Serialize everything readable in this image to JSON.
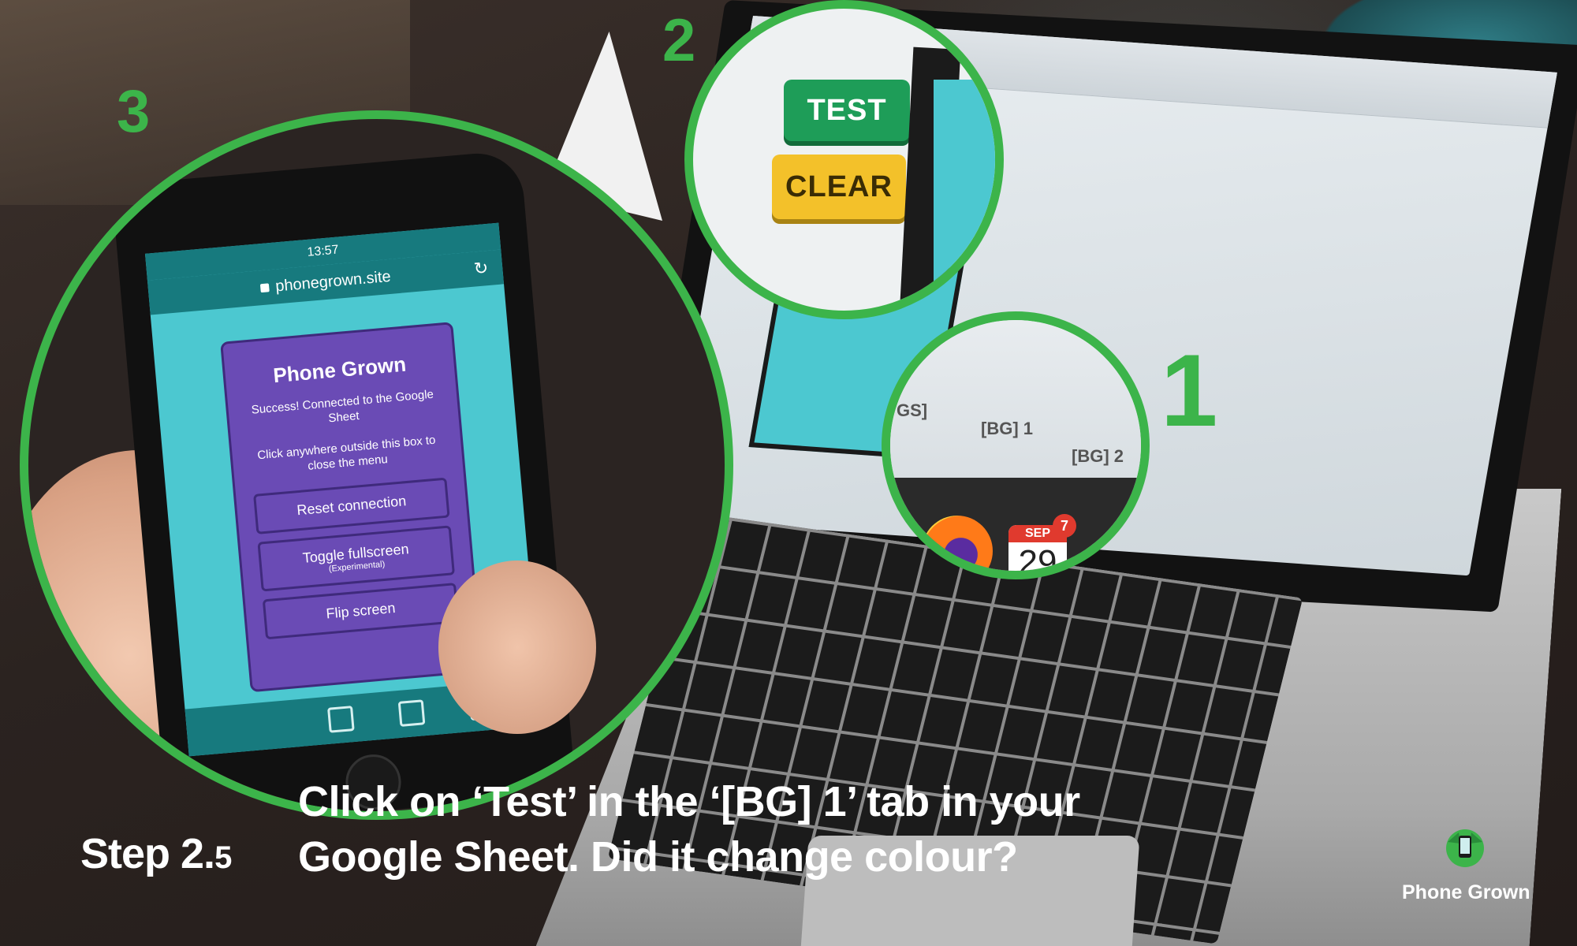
{
  "callouts": [
    {
      "number": "1"
    },
    {
      "number": "2"
    },
    {
      "number": "3"
    }
  ],
  "sheet": {
    "tabs": [
      "GS]",
      "[BG] 1",
      "[BG] 2"
    ],
    "buttons": {
      "test": "TEST",
      "clear": "CLEAR"
    }
  },
  "dock": {
    "calendar_month": "SEP",
    "calendar_day": "29",
    "badge_count": "7"
  },
  "phone": {
    "time": "13:57",
    "url": "phonegrown.site",
    "menu_title": "Phone Grown",
    "status_message": "Success! Connected to the Google Sheet",
    "hint": "Click anywhere outside this box to close the menu",
    "buttons": {
      "reset": "Reset connection",
      "fullscreen": "Toggle fullscreen",
      "fullscreen_note": "(Experimental)",
      "flip": "Flip screen"
    }
  },
  "caption": {
    "step_main": "Step 2.",
    "step_sub": "5",
    "instruction_line1": "Click on ‘Test’ in the ‘[BG] 1’ tab in your",
    "instruction_line2": "Google Sheet. Did it change colour?"
  },
  "brand": {
    "name": "Phone Grown",
    "color": "#3cb44a"
  }
}
